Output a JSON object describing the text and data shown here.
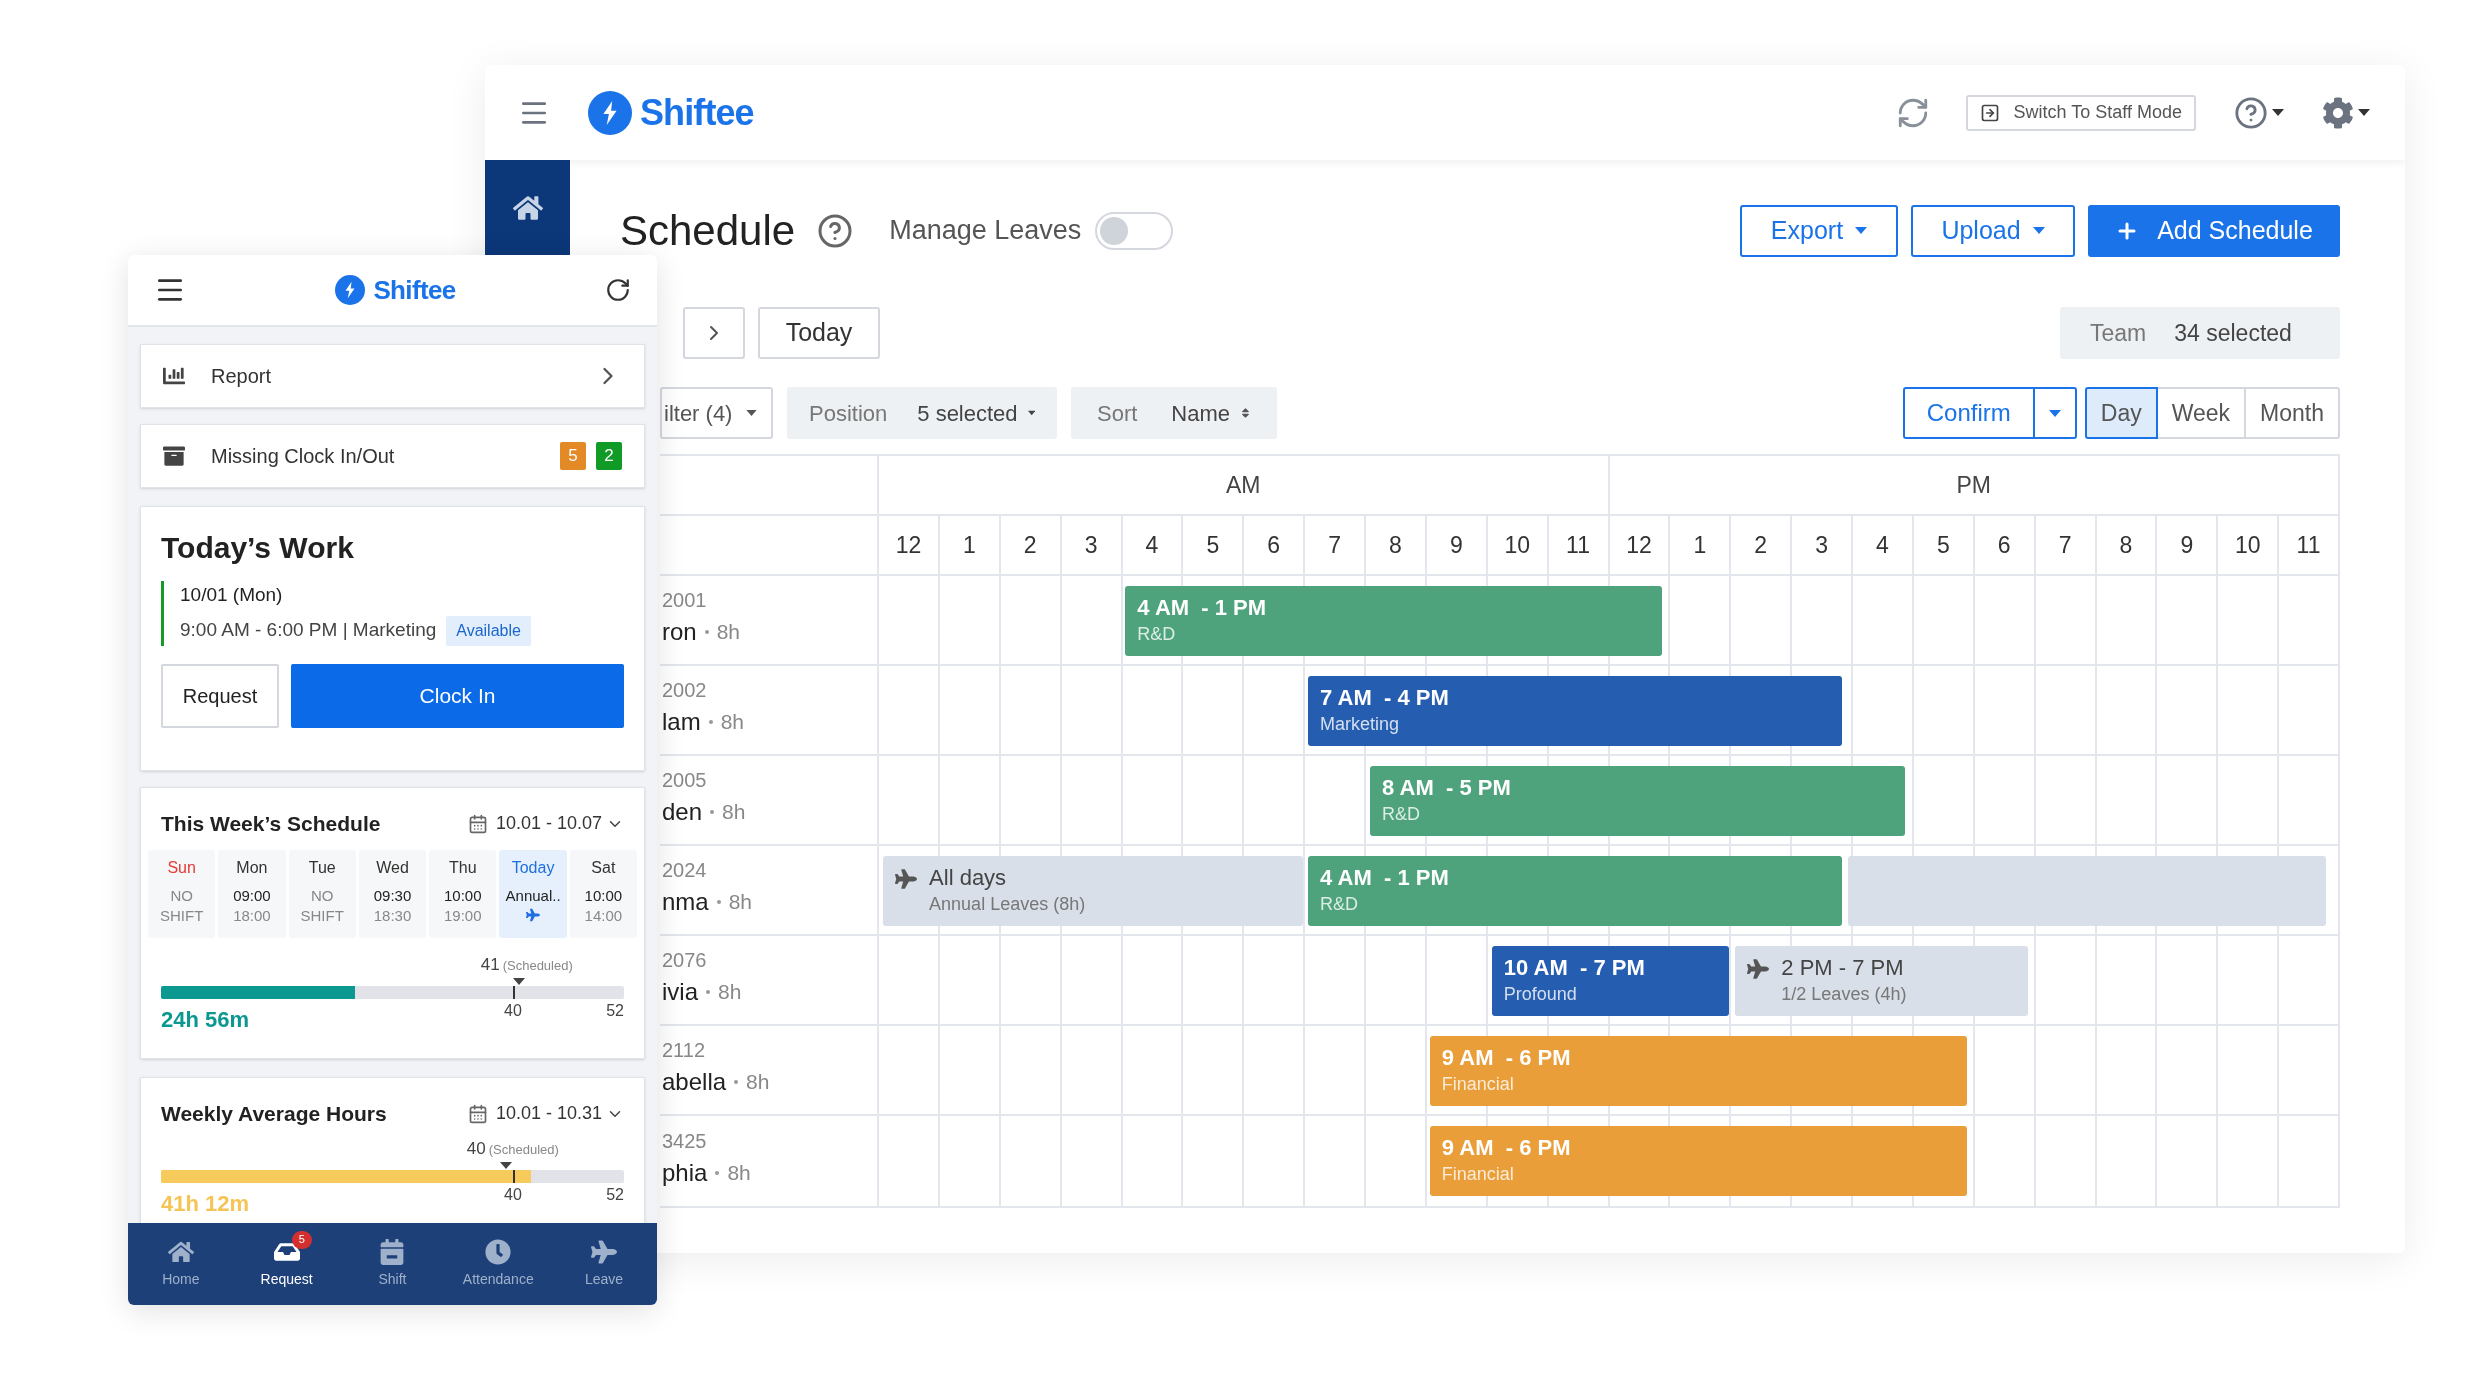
{
  "desktop": {
    "logo": "Shiftee",
    "switch_mode_button": "Switch To Staff Mode",
    "title": "Schedule",
    "manage_leaves": {
      "label": "Manage Leaves",
      "on": false
    },
    "export_button": "Export",
    "upload_button": "Upload",
    "add_button": "Add Schedule",
    "today_button": "Today",
    "team_filter": {
      "label": "Team",
      "value": "34 selected"
    },
    "filter_button": "ilter (4)",
    "position_filter": {
      "label": "Position",
      "value": "5 selected"
    },
    "sort": {
      "label": "Sort",
      "value": "Name"
    },
    "confirm_button": "Confirm",
    "views": [
      {
        "label": "Day",
        "selected": true
      },
      {
        "label": "Week",
        "selected": false
      },
      {
        "label": "Month",
        "selected": false
      }
    ],
    "timeline": {
      "periods": [
        "AM",
        "PM"
      ],
      "hours": [
        "12",
        "1",
        "2",
        "3",
        "4",
        "5",
        "6",
        "7",
        "8",
        "9",
        "10",
        "11",
        "12",
        "1",
        "2",
        "3",
        "4",
        "5",
        "6",
        "7",
        "8",
        "9",
        "10",
        "11"
      ],
      "rows": [
        {
          "id": "2001",
          "name": "ron",
          "hours": "8h",
          "bars": [
            {
              "kind": "shift",
              "time": "4 AM  - 1 PM",
              "department": "R&D",
              "color": "#4fa37c"
            }
          ]
        },
        {
          "id": "2002",
          "name": "lam",
          "hours": "8h",
          "bars": [
            {
              "kind": "shift",
              "time": "7 AM  - 4 PM",
              "department": "Marketing",
              "color": "#255db0"
            }
          ]
        },
        {
          "id": "2005",
          "name": "den",
          "hours": "8h",
          "bars": [
            {
              "kind": "shift",
              "time": "8 AM  - 5 PM",
              "department": "R&D",
              "color": "#4fa37c"
            }
          ]
        },
        {
          "id": "2024",
          "name": "nma",
          "hours": "8h",
          "bars": [
            {
              "kind": "leave",
              "time": "All days",
              "department": "Annual Leaves (8h)",
              "color": "#d8dfe8"
            },
            {
              "kind": "shift",
              "time": "4 AM  - 1 PM",
              "department": "R&D",
              "color": "#4fa37c"
            },
            {
              "kind": "leave_tail",
              "color": "#d8dfe8"
            }
          ]
        },
        {
          "id": "2076",
          "name": "ivia",
          "hours": "8h",
          "bars": [
            {
              "kind": "shift",
              "time": "10 AM  - 7 PM",
              "department": "Profound",
              "color": "#255db0"
            },
            {
              "kind": "leave",
              "time": "2 PM - 7 PM",
              "department": "1/2 Leaves (4h)",
              "color": "#d8dfe8"
            }
          ]
        },
        {
          "id": "2112",
          "name": "abella",
          "hours": "8h",
          "bars": [
            {
              "kind": "shift",
              "time": "9 AM  - 6 PM",
              "department": "Financial",
              "color": "#e99e39"
            }
          ]
        },
        {
          "id": "3425",
          "name": "phia",
          "hours": "8h",
          "bars": [
            {
              "kind": "shift",
              "time": "9 AM  - 6 PM",
              "department": "Financial",
              "color": "#e99e39"
            }
          ]
        }
      ]
    }
  },
  "mobile": {
    "logo": "Shiftee",
    "menu": [
      {
        "kind": "report",
        "label": "Report"
      },
      {
        "kind": "missing",
        "label": "Missing Clock In/Out",
        "badges": [
          {
            "count": "5",
            "color": "#e38a26"
          },
          {
            "count": "2",
            "color": "#109a26"
          }
        ]
      }
    ],
    "today": {
      "title": "Today’s Work",
      "date": "10/01 (Mon)",
      "shift": "9:00 AM - 6:00 PM | Marketing",
      "status": "Available",
      "request_button": "Request",
      "clock_button": "Clock In"
    },
    "week": {
      "title": "This Week’s Schedule",
      "range": "10.01 - 10.07",
      "days": [
        {
          "day": "Sun",
          "kind": "no_shift",
          "line1": "NO",
          "line2": "SHIFT",
          "color": "#e53935",
          "selected": false
        },
        {
          "day": "Mon",
          "kind": "shift",
          "line1": "09:00",
          "line2": "18:00",
          "color": "#333333",
          "selected": false
        },
        {
          "day": "Tue",
          "kind": "no_shift",
          "line1": "NO",
          "line2": "SHIFT",
          "color": "#333333",
          "selected": false
        },
        {
          "day": "Wed",
          "kind": "shift",
          "line1": "09:30",
          "line2": "18:30",
          "color": "#333333",
          "selected": false
        },
        {
          "day": "Thu",
          "kind": "shift",
          "line1": "10:00",
          "line2": "19:00",
          "color": "#333333",
          "selected": false
        },
        {
          "day": "Today",
          "kind": "leave",
          "line1": "Annual..",
          "color": "#1f6fe0",
          "selected": true
        },
        {
          "day": "Sat",
          "kind": "shift",
          "line1": "10:00",
          "line2": "14:00",
          "color": "#333333",
          "selected": false
        }
      ],
      "progress": {
        "scheduled": "41",
        "scheduled_label": "(Scheduled)",
        "level": 0.42,
        "ticks": [
          "40",
          "52"
        ],
        "total": "24h 56m"
      }
    },
    "average": {
      "title": "Weekly Average Hours",
      "range": "10.01 - 10.31",
      "progress": {
        "scheduled": "40",
        "scheduled_label": "(Scheduled)",
        "level": 0.8,
        "ticks": [
          "40",
          "52"
        ],
        "total": "41h 12m"
      }
    },
    "nav": [
      {
        "kind": "home",
        "label": "Home",
        "selected": false
      },
      {
        "kind": "request",
        "label": "Request",
        "selected": true,
        "badge": "5"
      },
      {
        "kind": "shift",
        "label": "Shift",
        "selected": false
      },
      {
        "kind": "attendance",
        "label": "Attendance",
        "selected": false
      },
      {
        "kind": "leave",
        "label": "Leave",
        "selected": false
      }
    ]
  }
}
